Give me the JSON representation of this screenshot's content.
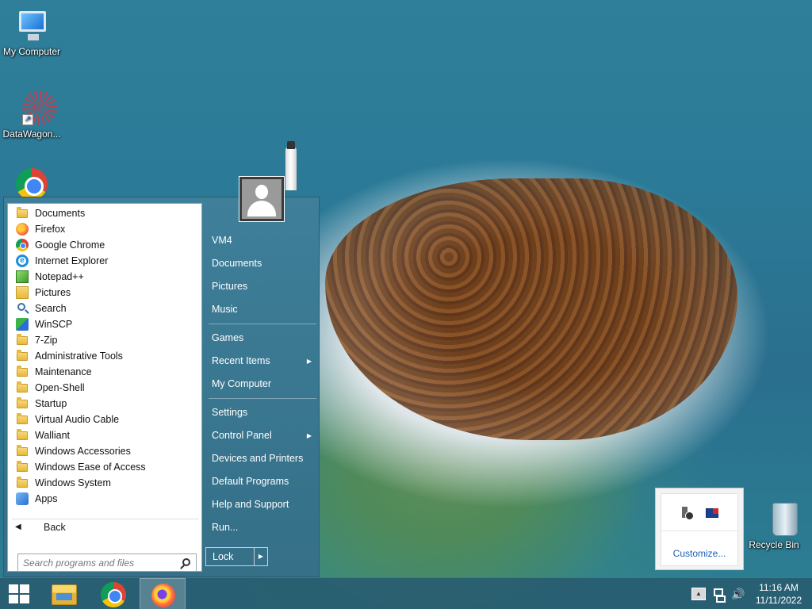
{
  "desktop": {
    "icons": [
      {
        "label": "My Computer"
      },
      {
        "label": "DataWagon..."
      },
      {
        "label": ""
      },
      {
        "label": "Recycle Bin"
      }
    ]
  },
  "start_menu": {
    "programs": [
      {
        "label": "Documents",
        "icon": "folder-icon"
      },
      {
        "label": "Firefox",
        "icon": "firefox-icon"
      },
      {
        "label": "Google Chrome",
        "icon": "chrome-icon"
      },
      {
        "label": "Internet Explorer",
        "icon": "internet-explorer-icon"
      },
      {
        "label": "Notepad++",
        "icon": "notepad-plus-plus-icon"
      },
      {
        "label": "Pictures",
        "icon": "pictures-icon"
      },
      {
        "label": "Search",
        "icon": "search-icon"
      },
      {
        "label": "WinSCP",
        "icon": "winscp-icon"
      },
      {
        "label": "7-Zip",
        "icon": "folder-icon"
      },
      {
        "label": "Administrative Tools",
        "icon": "folder-icon"
      },
      {
        "label": "Maintenance",
        "icon": "folder-icon"
      },
      {
        "label": "Open-Shell",
        "icon": "folder-icon"
      },
      {
        "label": "Startup",
        "icon": "folder-icon"
      },
      {
        "label": "Virtual Audio Cable",
        "icon": "folder-icon"
      },
      {
        "label": "Walliant",
        "icon": "folder-icon"
      },
      {
        "label": "Windows Accessories",
        "icon": "folder-icon"
      },
      {
        "label": "Windows Ease of Access",
        "icon": "folder-icon"
      },
      {
        "label": "Windows System",
        "icon": "folder-icon"
      },
      {
        "label": "Apps",
        "icon": "apps-icon"
      }
    ],
    "back_label": "Back",
    "search_placeholder": "Search programs and files",
    "places": {
      "user": "VM4",
      "documents": "Documents",
      "pictures": "Pictures",
      "music": "Music",
      "games": "Games",
      "recent_items": "Recent Items",
      "my_computer": "My Computer",
      "settings": "Settings",
      "control_panel": "Control Panel",
      "devices_printers": "Devices and Printers",
      "default_programs": "Default Programs",
      "help_support": "Help and Support",
      "run": "Run..."
    },
    "lock_label": "Lock"
  },
  "tray_popup": {
    "customize_label": "Customize..."
  },
  "taskbar": {
    "time": "11:16 AM",
    "date": "11/11/2022"
  }
}
